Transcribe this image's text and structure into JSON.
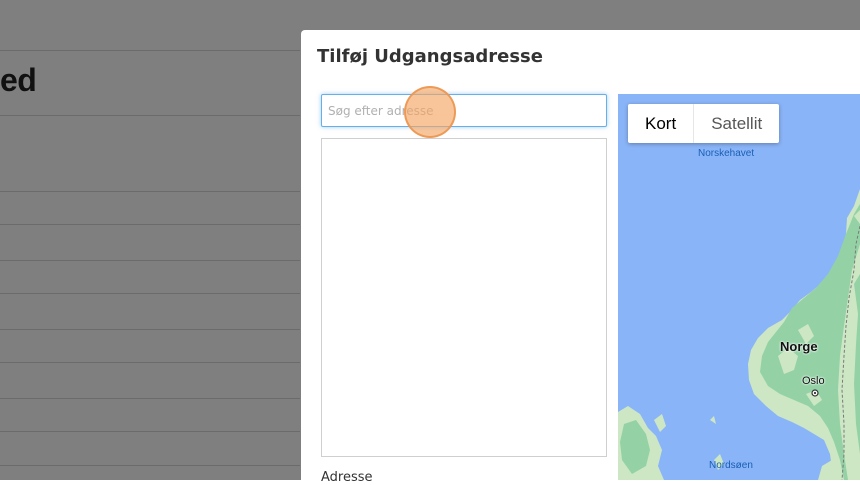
{
  "background": {
    "heading_fragment": "ed"
  },
  "modal": {
    "title": "Tilføj Udgangsadresse",
    "search": {
      "placeholder": "Søg efter adresse",
      "value": ""
    },
    "address_label": "Adresse"
  },
  "map": {
    "map_types": [
      {
        "label": "Kort",
        "selected": true
      },
      {
        "label": "Satellit",
        "selected": false
      }
    ],
    "labels": {
      "sea_north": "Norskehavet",
      "sea_south": "Nordsøen",
      "country": "Norge",
      "city": "Oslo"
    },
    "colors": {
      "water": "#8ab4f8",
      "land": "#cde7c4",
      "forest": "#94d2a5"
    }
  },
  "colors": {
    "input_focus": "#66afe9",
    "click_indicator": "#f5a664"
  }
}
